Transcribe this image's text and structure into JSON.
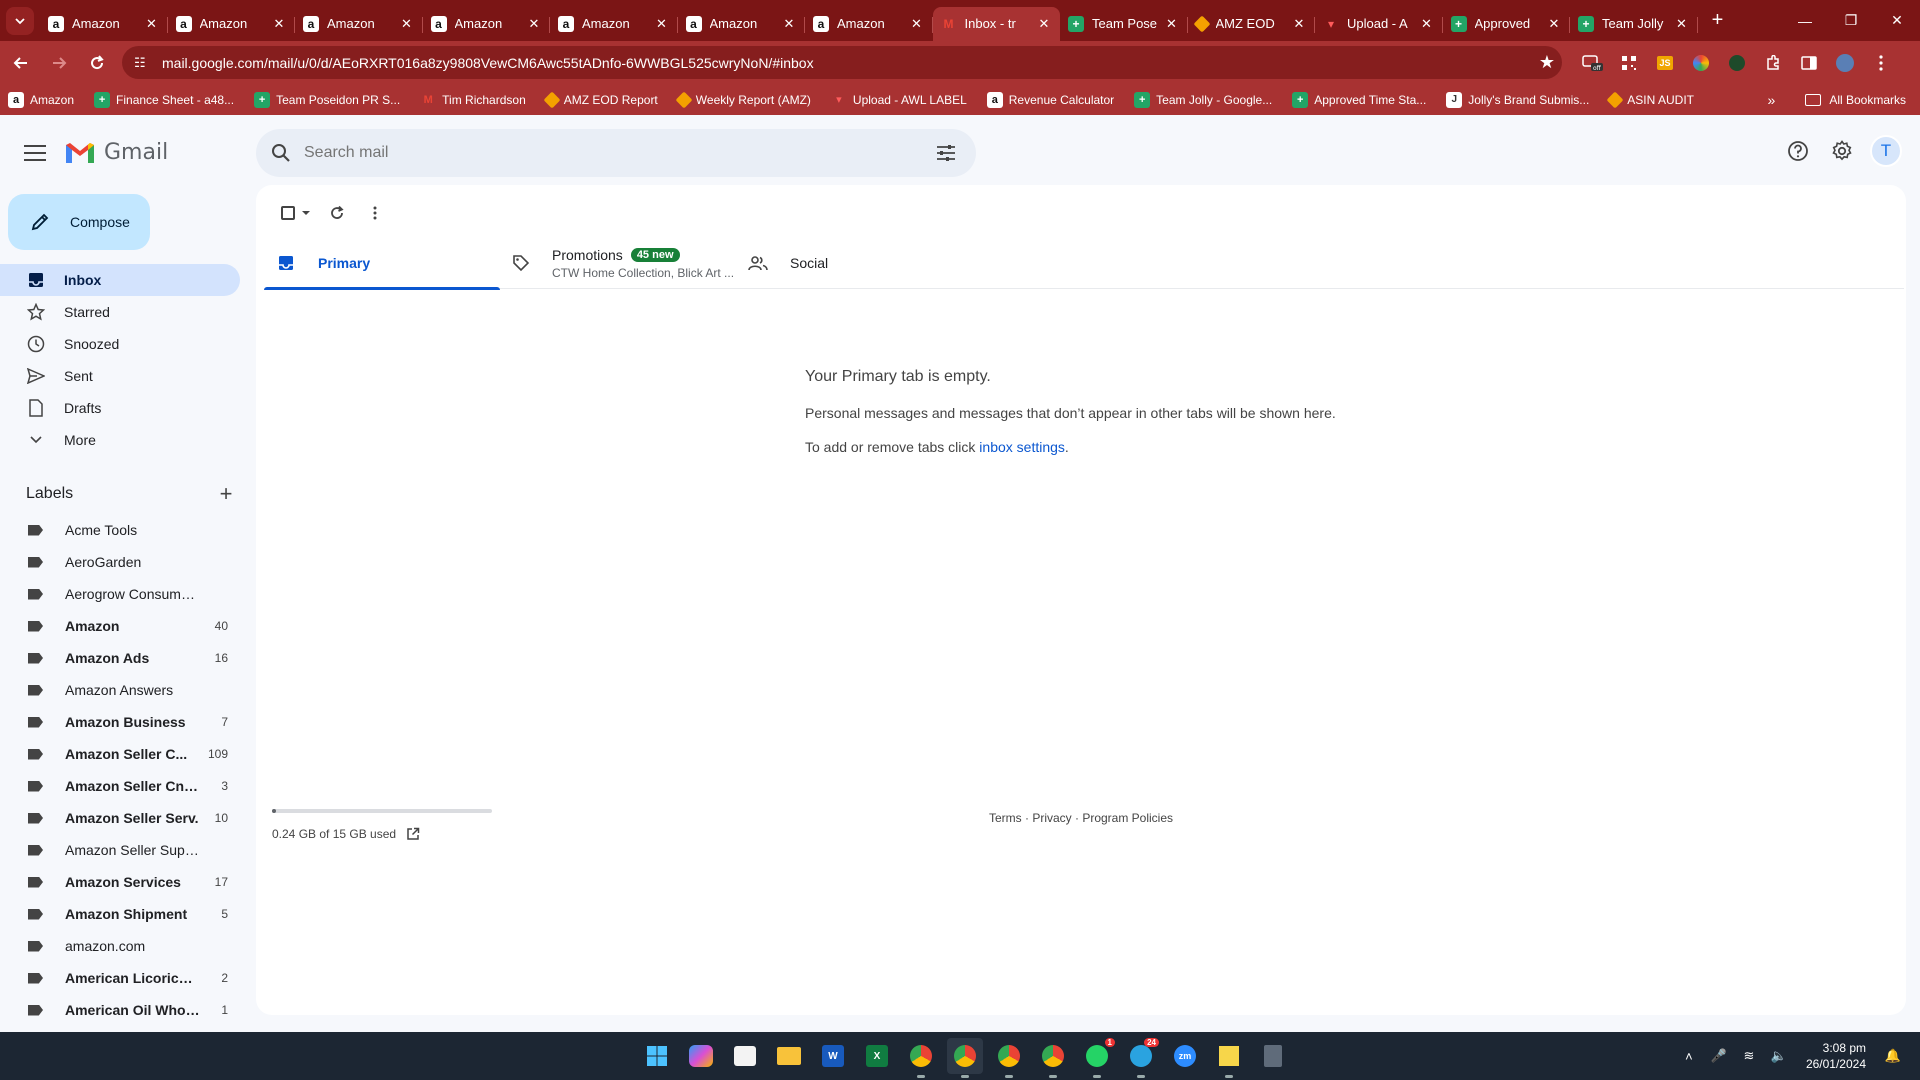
{
  "browser": {
    "tabs": [
      {
        "title": "Amazon",
        "icon": "amazon-icon"
      },
      {
        "title": "Amazon",
        "icon": "amazon-icon"
      },
      {
        "title": "Amazon",
        "icon": "amazon-icon"
      },
      {
        "title": "Amazon",
        "icon": "amazon-icon"
      },
      {
        "title": "Amazon",
        "icon": "amazon-icon"
      },
      {
        "title": "Amazon",
        "icon": "amazon-icon"
      },
      {
        "title": "Amazon",
        "icon": "amazon-icon"
      },
      {
        "title": "Inbox - tr",
        "icon": "gmail-icon"
      },
      {
        "title": "Team Pose",
        "icon": "sheets-icon"
      },
      {
        "title": "AMZ EOD",
        "icon": "eod-icon"
      },
      {
        "title": "Upload - A",
        "icon": "upload-icon"
      },
      {
        "title": "Approved",
        "icon": "sheets-icon"
      },
      {
        "title": "Team Jolly",
        "icon": "sheets-icon"
      }
    ],
    "url": "mail.google.com/mail/u/0/d/AEoRXRT016a8zy9808VewCM6Awc55tADnfo-6WWBGL525cwryNoN/#inbox",
    "bookmarks": [
      {
        "label": "Amazon",
        "icon": "amz"
      },
      {
        "label": "Finance Sheet - a48...",
        "icon": "sheet"
      },
      {
        "label": "Team Poseidon PR S...",
        "icon": "sheet"
      },
      {
        "label": "Tim Richardson",
        "icon": "gm"
      },
      {
        "label": "AMZ EOD Report",
        "icon": "eod"
      },
      {
        "label": "Weekly Report (AMZ)",
        "icon": "eod"
      },
      {
        "label": "Upload - AWL LABEL",
        "icon": "up"
      },
      {
        "label": "Revenue Calculator",
        "icon": "amz"
      },
      {
        "label": "Team Jolly - Google...",
        "icon": "sheet"
      },
      {
        "label": "Approved Time Sta...",
        "icon": "sheet"
      },
      {
        "label": "Jolly's Brand Submis...",
        "icon": "jb"
      },
      {
        "label": "ASIN AUDIT",
        "icon": "eod"
      }
    ],
    "all_bookmarks": "All Bookmarks",
    "accent": "#a83232"
  },
  "gmail": {
    "product": "Gmail",
    "search_placeholder": "Search mail",
    "avatar_letter": "T",
    "compose": "Compose",
    "nav": [
      {
        "label": "Inbox",
        "icon": "inbox-icon",
        "active": true
      },
      {
        "label": "Starred",
        "icon": "star-icon"
      },
      {
        "label": "Snoozed",
        "icon": "clock-icon"
      },
      {
        "label": "Sent",
        "icon": "send-icon"
      },
      {
        "label": "Drafts",
        "icon": "draft-icon"
      },
      {
        "label": "More",
        "icon": "chevron-down-icon"
      }
    ],
    "labels_heading": "Labels",
    "labels": [
      {
        "name": "Acme Tools",
        "count": "",
        "bold": false
      },
      {
        "name": "AeroGarden",
        "count": "",
        "bold": false
      },
      {
        "name": "Aerogrow Consumer Se...",
        "count": "",
        "bold": false
      },
      {
        "name": "Amazon",
        "count": "40",
        "bold": true
      },
      {
        "name": "Amazon Ads",
        "count": "16",
        "bold": true
      },
      {
        "name": "Amazon Answers",
        "count": "",
        "bold": false
      },
      {
        "name": "Amazon Business",
        "count": "7",
        "bold": true
      },
      {
        "name": "Amazon Seller C...",
        "count": "109",
        "bold": true
      },
      {
        "name": "Amazon Seller Cntr...",
        "count": "3",
        "bold": true
      },
      {
        "name": "Amazon Seller Serv.",
        "count": "10",
        "bold": true
      },
      {
        "name": "Amazon Seller Support",
        "count": "",
        "bold": false
      },
      {
        "name": "Amazon Services",
        "count": "17",
        "bold": true
      },
      {
        "name": "Amazon Shipment",
        "count": "5",
        "bold": true
      },
      {
        "name": "amazon.com",
        "count": "",
        "bold": false
      },
      {
        "name": "American Licorice ...",
        "count": "2",
        "bold": true
      },
      {
        "name": "American Oil Whol...",
        "count": "1",
        "bold": true
      }
    ],
    "tabs": {
      "primary": "Primary",
      "promotions": "Promotions",
      "promotions_badge": "45 new",
      "promotions_sub": "CTW Home Collection, Blick Art ...",
      "social": "Social"
    },
    "empty": {
      "title": "Your Primary tab is empty.",
      "line1": "Personal messages and messages that don’t appear in other tabs will be shown here.",
      "line2_prefix": "To add or remove tabs click ",
      "line2_link": "inbox settings",
      "line2_suffix": "."
    },
    "storage": {
      "text": "0.24 GB of 15 GB used",
      "fraction": 0.016
    },
    "footer": {
      "terms": "Terms",
      "privacy": "Privacy",
      "policies": "Program Policies",
      "sep": " · "
    }
  },
  "taskbar": {
    "time": "3:08 pm",
    "date": "26/01/2024",
    "whatsapp_badge": "1",
    "telegram_badge": "24"
  }
}
